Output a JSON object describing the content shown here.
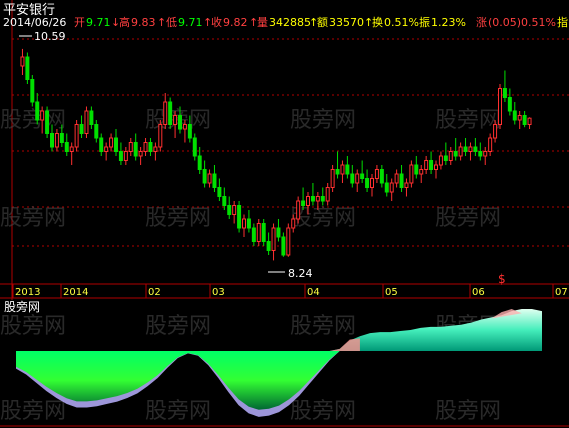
{
  "title": "平安银行",
  "quote": {
    "date": "2014/06/26",
    "open_label": "开",
    "open": "9.71",
    "high_label": "高",
    "high": "9.83",
    "low_label": "低",
    "low": "9.71",
    "close_label": "收",
    "close": "9.82",
    "volume_label": "量",
    "volume": "342885",
    "amount_label": "额",
    "amount": "33570",
    "turnover_label": "换",
    "turnover": "0.51%",
    "amplitude_label": "振",
    "amplitude": "1.23%",
    "change_label": "涨",
    "change": "(0.05)",
    "change_pct": "0.51%",
    "extra_label": "指"
  },
  "watermark": "股旁网",
  "indicator_title": "股旁网",
  "annotations": {
    "high_marker": "10.59",
    "low_marker": "8.24",
    "event_marker": "$"
  },
  "colors": {
    "up": "#ff3030",
    "down": "#00e000",
    "grid": "#b00000",
    "axis_text": "#ffff40",
    "quote_label": "#ffffff",
    "quote_value": "#ffff00"
  },
  "chart_data": [
    {
      "type": "candlestick",
      "title": "平安银行",
      "x_tick_labels": [
        "2013",
        "2014",
        "02",
        "03",
        "04",
        "05",
        "06",
        "07"
      ],
      "ylim": [
        8.0,
        10.8
      ],
      "grid": true,
      "series": [
        {
          "values": [
            [
              10.4,
              10.59,
              10.3,
              10.5
            ],
            [
              10.5,
              10.55,
              10.2,
              10.25
            ],
            [
              10.25,
              10.3,
              9.95,
              10.0
            ],
            [
              10.0,
              10.1,
              9.75,
              9.8
            ],
            [
              9.8,
              9.95,
              9.65,
              9.9
            ],
            [
              9.9,
              9.95,
              9.6,
              9.65
            ],
            [
              9.65,
              9.75,
              9.45,
              9.5
            ],
            [
              9.5,
              9.7,
              9.45,
              9.65
            ],
            [
              9.65,
              9.75,
              9.5,
              9.55
            ],
            [
              9.55,
              9.65,
              9.4,
              9.45
            ],
            [
              9.45,
              9.55,
              9.3,
              9.5
            ],
            [
              9.5,
              9.8,
              9.45,
              9.75
            ],
            [
              9.75,
              9.85,
              9.6,
              9.65
            ],
            [
              9.65,
              9.95,
              9.6,
              9.9
            ],
            [
              9.9,
              9.95,
              9.7,
              9.75
            ],
            [
              9.75,
              9.8,
              9.55,
              9.6
            ],
            [
              9.6,
              9.65,
              9.4,
              9.45
            ],
            [
              9.45,
              9.55,
              9.35,
              9.5
            ],
            [
              9.5,
              9.65,
              9.45,
              9.6
            ],
            [
              9.6,
              9.7,
              9.4,
              9.45
            ],
            [
              9.45,
              9.55,
              9.3,
              9.35
            ],
            [
              9.35,
              9.5,
              9.3,
              9.45
            ],
            [
              9.45,
              9.6,
              9.4,
              9.55
            ],
            [
              9.55,
              9.65,
              9.35,
              9.4
            ],
            [
              9.4,
              9.5,
              9.3,
              9.45
            ],
            [
              9.45,
              9.6,
              9.4,
              9.55
            ],
            [
              9.55,
              9.6,
              9.4,
              9.45
            ],
            [
              9.45,
              9.55,
              9.35,
              9.5
            ],
            [
              9.5,
              9.8,
              9.45,
              9.75
            ],
            [
              9.75,
              10.1,
              9.7,
              10.0
            ],
            [
              10.0,
              10.05,
              9.7,
              9.75
            ],
            [
              9.75,
              9.9,
              9.6,
              9.85
            ],
            [
              9.85,
              9.95,
              9.65,
              9.7
            ],
            [
              9.7,
              9.8,
              9.55,
              9.75
            ],
            [
              9.75,
              9.85,
              9.55,
              9.6
            ],
            [
              9.6,
              9.65,
              9.35,
              9.4
            ],
            [
              9.4,
              9.5,
              9.2,
              9.25
            ],
            [
              9.25,
              9.35,
              9.05,
              9.1
            ],
            [
              9.1,
              9.25,
              9.05,
              9.2
            ],
            [
              9.2,
              9.3,
              9.0,
              9.05
            ],
            [
              9.05,
              9.15,
              8.9,
              8.95
            ],
            [
              8.95,
              9.05,
              8.8,
              8.85
            ],
            [
              8.85,
              8.95,
              8.7,
              8.75
            ],
            [
              8.75,
              8.9,
              8.65,
              8.85
            ],
            [
              8.85,
              8.9,
              8.55,
              8.6
            ],
            [
              8.6,
              8.75,
              8.5,
              8.7
            ],
            [
              8.7,
              8.8,
              8.55,
              8.6
            ],
            [
              8.6,
              8.65,
              8.4,
              8.45
            ],
            [
              8.45,
              8.7,
              8.4,
              8.65
            ],
            [
              8.65,
              8.7,
              8.4,
              8.45
            ],
            [
              8.45,
              8.55,
              8.3,
              8.35
            ],
            [
              8.35,
              8.65,
              8.24,
              8.6
            ],
            [
              8.6,
              8.7,
              8.45,
              8.5
            ],
            [
              8.5,
              8.55,
              8.28,
              8.3
            ],
            [
              8.3,
              8.65,
              8.28,
              8.6
            ],
            [
              8.6,
              8.75,
              8.55,
              8.7
            ],
            [
              8.7,
              8.95,
              8.65,
              8.9
            ],
            [
              8.9,
              9.05,
              8.8,
              8.85
            ],
            [
              8.85,
              9.0,
              8.75,
              8.95
            ],
            [
              8.95,
              9.1,
              8.85,
              8.9
            ],
            [
              8.9,
              9.0,
              8.8,
              8.95
            ],
            [
              8.95,
              9.05,
              8.85,
              8.9
            ],
            [
              8.9,
              9.1,
              8.85,
              9.05
            ],
            [
              9.05,
              9.3,
              9.0,
              9.25
            ],
            [
              9.25,
              9.45,
              9.15,
              9.2
            ],
            [
              9.2,
              9.35,
              9.1,
              9.3
            ],
            [
              9.3,
              9.4,
              9.15,
              9.2
            ],
            [
              9.2,
              9.3,
              9.05,
              9.1
            ],
            [
              9.1,
              9.25,
              9.0,
              9.2
            ],
            [
              9.2,
              9.35,
              9.1,
              9.15
            ],
            [
              9.15,
              9.25,
              9.0,
              9.05
            ],
            [
              9.05,
              9.2,
              8.95,
              9.15
            ],
            [
              9.15,
              9.3,
              9.1,
              9.25
            ],
            [
              9.25,
              9.3,
              9.05,
              9.1
            ],
            [
              9.1,
              9.2,
              8.95,
              9.0
            ],
            [
              9.0,
              9.15,
              8.9,
              9.1
            ],
            [
              9.1,
              9.25,
              9.05,
              9.2
            ],
            [
              9.2,
              9.3,
              9.0,
              9.05
            ],
            [
              9.05,
              9.15,
              8.95,
              9.1
            ],
            [
              9.1,
              9.35,
              9.05,
              9.3
            ],
            [
              9.3,
              9.4,
              9.15,
              9.2
            ],
            [
              9.2,
              9.3,
              9.1,
              9.25
            ],
            [
              9.25,
              9.4,
              9.2,
              9.35
            ],
            [
              9.35,
              9.45,
              9.2,
              9.25
            ],
            [
              9.25,
              9.35,
              9.15,
              9.3
            ],
            [
              9.3,
              9.45,
              9.25,
              9.4
            ],
            [
              9.4,
              9.55,
              9.3,
              9.35
            ],
            [
              9.35,
              9.5,
              9.3,
              9.45
            ],
            [
              9.45,
              9.6,
              9.35,
              9.4
            ],
            [
              9.4,
              9.55,
              9.35,
              9.5
            ],
            [
              9.5,
              9.6,
              9.4,
              9.45
            ],
            [
              9.45,
              9.55,
              9.35,
              9.5
            ],
            [
              9.5,
              9.6,
              9.4,
              9.45
            ],
            [
              9.45,
              9.55,
              9.35,
              9.4
            ],
            [
              9.4,
              9.5,
              9.3,
              9.45
            ],
            [
              9.45,
              9.65,
              9.4,
              9.6
            ],
            [
              9.6,
              9.8,
              9.55,
              9.75
            ],
            [
              9.75,
              10.2,
              9.7,
              10.15
            ],
            [
              10.15,
              10.35,
              10.0,
              10.05
            ],
            [
              10.05,
              10.15,
              9.85,
              9.9
            ],
            [
              9.9,
              10.0,
              9.75,
              9.8
            ],
            [
              9.8,
              9.9,
              9.7,
              9.85
            ],
            [
              9.85,
              9.9,
              9.72,
              9.75
            ],
            [
              9.75,
              9.83,
              9.7,
              9.82
            ]
          ]
        }
      ]
    },
    {
      "type": "area",
      "title": "股旁网",
      "grid": false,
      "series": [
        {
          "values": [
            -0.15,
            -0.2,
            -0.27,
            -0.34,
            -0.4,
            -0.45,
            -0.48,
            -0.48,
            -0.47,
            -0.45,
            -0.43,
            -0.4,
            -0.36,
            -0.3,
            -0.23,
            -0.14,
            -0.06,
            -0.02,
            -0.04,
            -0.12,
            -0.23,
            -0.35,
            -0.46,
            -0.53,
            -0.56,
            -0.55,
            -0.52,
            -0.46,
            -0.38,
            -0.28,
            -0.18,
            -0.08,
            0.02,
            0.1,
            0.14,
            0.17,
            0.18,
            0.18,
            0.19,
            0.2,
            0.22,
            0.23,
            0.23,
            0.24,
            0.25,
            0.27,
            0.3,
            0.32,
            0.34,
            0.38,
            0.4,
            0.4,
            0.38
          ]
        }
      ]
    }
  ]
}
